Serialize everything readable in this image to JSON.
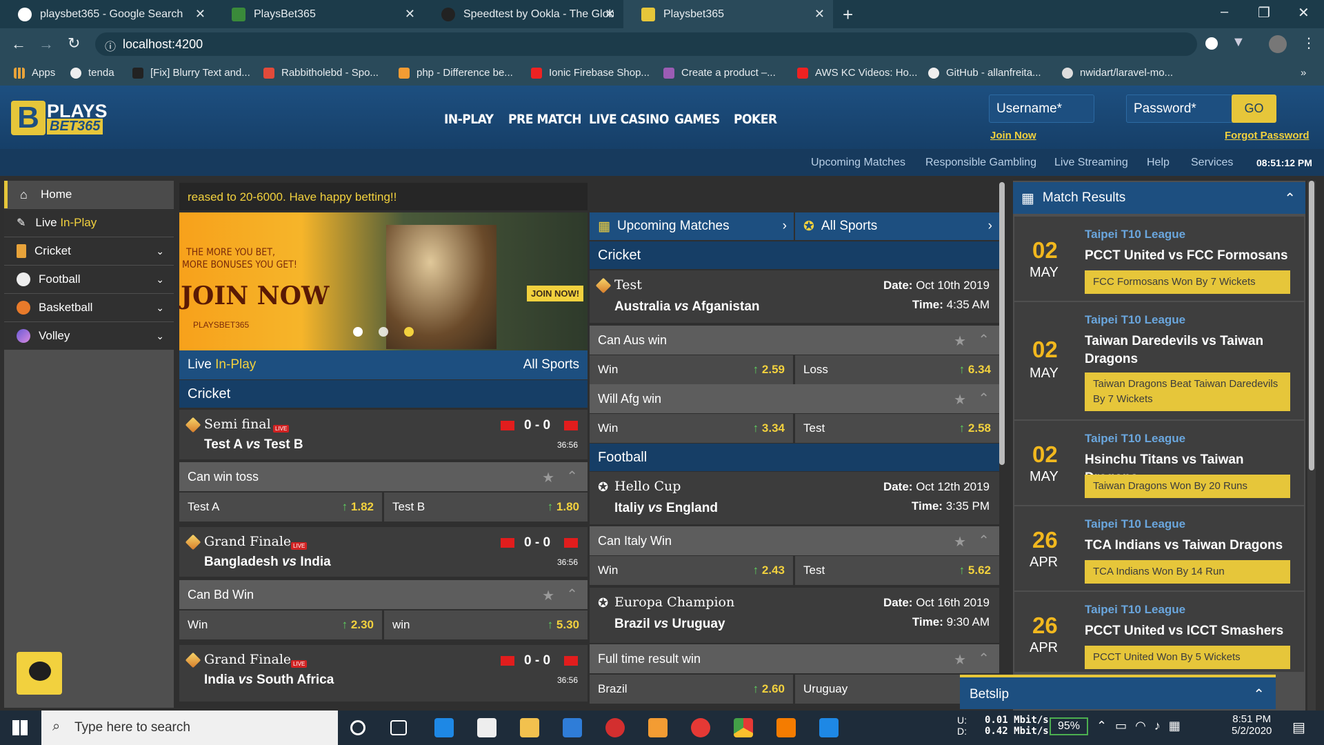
{
  "browser": {
    "tabs": [
      {
        "label": "playsbet365 - Google Search",
        "color": "#ffffff"
      },
      {
        "label": "PlaysBet365",
        "color": "#3a8a3a"
      },
      {
        "label": "Speedtest by Ookla - The Global",
        "color": "#222222"
      },
      {
        "label": "Playsbet365",
        "color": "#e6c63a"
      }
    ],
    "url": "localhost:4200",
    "bookmarks": [
      "Apps",
      "tenda",
      "[Fix] Blurry Text and...",
      "Rabbitholebd - Spo...",
      "php - Difference be...",
      "Ionic Firebase Shop...",
      "Create a product –...",
      "AWS KC Videos: Ho...",
      "GitHub - allanfreita...",
      "nwidart/laravel-mo..."
    ]
  },
  "header": {
    "logo_top": "PLAYS",
    "logo_bottom": "BET365",
    "nav": [
      "IN-PLAY",
      "PRE MATCH",
      "LIVE CASINO",
      "GAMES",
      "POKER"
    ],
    "username_placeholder": "Username*",
    "password_placeholder": "Password*",
    "go": "GO",
    "join": "Join Now",
    "forgot": "Forgot Password",
    "subnav": [
      "Upcoming Matches",
      "Responsible Gambling",
      "Live Streaming",
      "Help",
      "Services"
    ],
    "clock": "08:51:12 PM"
  },
  "sidebar": [
    {
      "label": "Home"
    },
    {
      "label": "Live",
      "accent": "In-Play"
    },
    {
      "label": "Cricket"
    },
    {
      "label": "Football"
    },
    {
      "label": "Basketball"
    },
    {
      "label": "Volley"
    }
  ],
  "ticker": "reased to 20-6000. Have happy betting!!",
  "banner": {
    "line1": "THE MORE YOU BET,",
    "line2": "MORE BONUSES YOU GET!",
    "cta": "JOIN NOW",
    "site": "PLAYSBET365",
    "btn": "JOIN NOW!"
  },
  "inplay": {
    "title": "Live",
    "accent": "In-Play",
    "all": "All Sports",
    "section": "Cricket",
    "matches": [
      {
        "type": "Semi final",
        "home": "Test A",
        "away": "Test B",
        "score": "0 - 0",
        "time": "36:56",
        "question": "Can win toss",
        "o1": "Test A",
        "v1": "1.82",
        "o2": "Test B",
        "v2": "1.80"
      },
      {
        "type": "Grand Finale",
        "home": "Bangladesh",
        "away": "India",
        "score": "0 - 0",
        "time": "36:56",
        "question": "Can Bd Win",
        "o1": "Win",
        "v1": "2.30",
        "o2": "win",
        "v2": "5.30"
      },
      {
        "type": "Grand Finale",
        "home": "India",
        "away": "South Africa",
        "score": "0 - 0",
        "time": "36:56"
      }
    ],
    "vs": "vs",
    "live": "LIVE"
  },
  "upcoming": {
    "title": "Upcoming Matches",
    "all": "All Sports",
    "date_label": "Date:",
    "time_label": "Time:",
    "cricket": "Cricket",
    "football": "Football",
    "matches": [
      {
        "type": "Test",
        "home": "Australia",
        "away": "Afganistan",
        "date": "Oct 10th 2019",
        "time": "4:35 AM",
        "markets": [
          {
            "q": "Can Aus win",
            "o1": "Win",
            "v1": "2.59",
            "o2": "Loss",
            "v2": "6.34"
          },
          {
            "q": "Will Afg win",
            "o1": "Win",
            "v1": "3.34",
            "o2": "Test",
            "v2": "2.58"
          }
        ]
      },
      {
        "type": "Hello Cup",
        "home": "Italiy",
        "away": "England",
        "date": "Oct 12th 2019",
        "time": "3:35 PM",
        "markets": [
          {
            "q": "Can Italy Win",
            "o1": "Win",
            "v1": "2.43",
            "o2": "Test",
            "v2": "5.62"
          }
        ]
      },
      {
        "type": "Europa Champion",
        "home": "Brazil",
        "away": "Uruguay",
        "date": "Oct 16th 2019",
        "time": "9:30 AM",
        "markets": [
          {
            "q": "Full time result win",
            "o1": "Brazil",
            "v1": "2.60",
            "o2": "Uruguay",
            "v2": ""
          }
        ]
      }
    ]
  },
  "results": {
    "title": "Match Results",
    "items": [
      {
        "day": "02",
        "month": "MAY",
        "league": "Taipei T10 League",
        "match": "PCCT United vs FCC Formosans",
        "result": "FCC Formosans Won By 7 Wickets"
      },
      {
        "day": "02",
        "month": "MAY",
        "league": "Taipei T10 League",
        "match": "Taiwan Daredevils vs Taiwan Dragons",
        "result": "Taiwan Dragons Beat Taiwan Daredevils By 7 Wickets"
      },
      {
        "day": "02",
        "month": "MAY",
        "league": "Taipei T10 League",
        "match": "Hsinchu Titans vs Taiwan Dragons",
        "result": "Taiwan Dragons Won By 20 Runs"
      },
      {
        "day": "26",
        "month": "APR",
        "league": "Taipei T10 League",
        "match": "TCA Indians vs Taiwan Dragons",
        "result": "TCA Indians Won By 14 Run"
      },
      {
        "day": "26",
        "month": "APR",
        "league": "Taipei T10 League",
        "match": "PCCT United vs ICCT Smashers",
        "result": "PCCT United Won By 5 Wickets"
      }
    ]
  },
  "betslip": "Betslip",
  "taskbar": {
    "search": "Type here to search",
    "up": "U:",
    "down": "D:",
    "up_val": "0.01 Mbit/s",
    "down_val": "0.42 Mbit/s",
    "battery": "95%",
    "time": "8:51 PM",
    "date": "5/2/2020"
  }
}
